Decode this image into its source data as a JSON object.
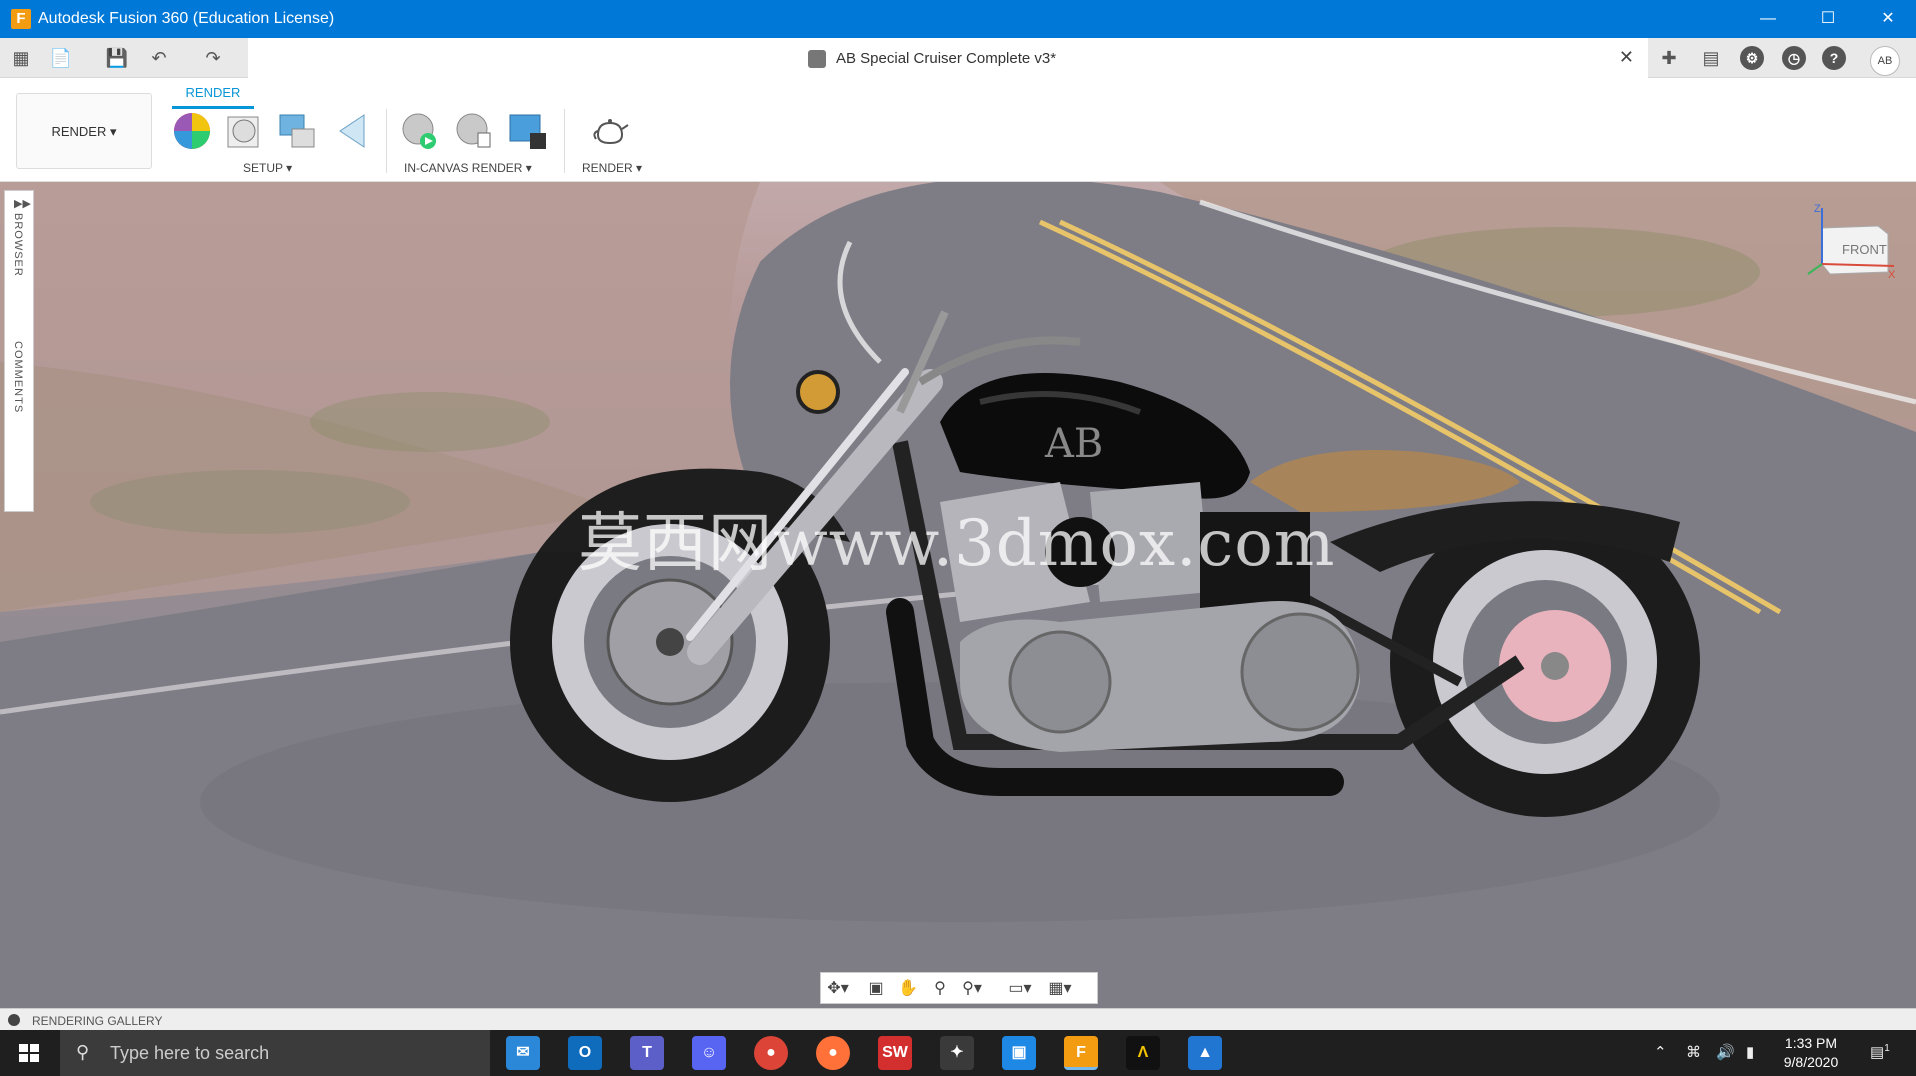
{
  "window": {
    "title": "Autodesk Fusion 360 (Education License)"
  },
  "document_tab": {
    "title": "AB Special Cruiser Complete v3*"
  },
  "user": {
    "initials": "AB"
  },
  "toolbar": {
    "workspace": "RENDER",
    "active_tab": "RENDER",
    "groups": [
      {
        "label": "SETUP"
      },
      {
        "label": "IN-CANVAS RENDER"
      },
      {
        "label": "RENDER"
      }
    ]
  },
  "side_panel": {
    "browser_label": "BROWSER",
    "comments_label": "COMMENTS"
  },
  "viewcube": {
    "face_label": "FRONT",
    "axis_z": "Z",
    "axis_x": "X"
  },
  "watermark": {
    "text": "莫西网www.3dmox.com"
  },
  "tank_logo": "AB",
  "gallery": {
    "label": "RENDERING GALLERY"
  },
  "taskbar": {
    "search_placeholder": "Type here to search",
    "time": "1:33 PM",
    "date": "9/8/2020",
    "notification_count": "1",
    "apps": [
      "mail-icon",
      "outlook-icon",
      "teams-icon",
      "discord-icon",
      "chrome-icon",
      "firefox-icon",
      "solidworks-icon",
      "3dexperience-icon",
      "file-explorer-icon",
      "fusion360-icon",
      "autodesk-icon",
      "photos-icon"
    ]
  },
  "colors": {
    "titlebar": "#0078d7",
    "accent": "#0696d7",
    "taskbar": "#1f1f1f"
  }
}
